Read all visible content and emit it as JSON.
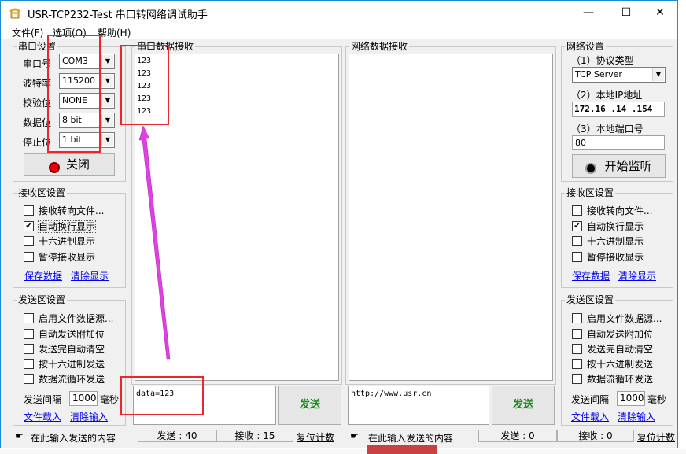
{
  "window": {
    "title": "USR-TCP232-Test 串口转网络调试助手",
    "minimize": "—",
    "maximize": "☐",
    "close": "✕"
  },
  "menu": [
    "文件(F)",
    "选项(O)",
    "帮助(H)"
  ],
  "serial_settings": {
    "title": "串口设置",
    "fields": [
      {
        "label": "串口号",
        "value": "COM3"
      },
      {
        "label": "波特率",
        "value": "115200"
      },
      {
        "label": "校验位",
        "value": "NONE"
      },
      {
        "label": "数据位",
        "value": "8 bit"
      },
      {
        "label": "停止位",
        "value": "1 bit"
      }
    ],
    "button": "关闭"
  },
  "left_receive": {
    "title": "接收区设置",
    "options": [
      {
        "label": "接收转向文件...",
        "checked": false
      },
      {
        "label": "自动换行显示",
        "checked": true
      },
      {
        "label": "十六进制显示",
        "checked": false
      },
      {
        "label": "暂停接收显示",
        "checked": false
      }
    ],
    "link1": "保存数据",
    "link2": "清除显示"
  },
  "left_send": {
    "title": "发送区设置",
    "options": [
      {
        "label": "启用文件数据源...",
        "checked": false
      },
      {
        "label": "自动发送附加位",
        "checked": false
      },
      {
        "label": "发送完自动清空",
        "checked": false
      },
      {
        "label": "按十六进制发送",
        "checked": false
      },
      {
        "label": "数据流循环发送",
        "checked": false
      }
    ],
    "interval_label": "发送间隔",
    "interval_value": "1000",
    "interval_unit": "毫秒",
    "link1": "文件载入",
    "link2": "清除输入"
  },
  "serial_rx": {
    "title": "串口数据接收",
    "lines": [
      "123",
      "123",
      "123",
      "123",
      "123"
    ]
  },
  "net_rx": {
    "title": "网络数据接收"
  },
  "serial_tx": {
    "text": "data=123",
    "button": "发送"
  },
  "net_tx": {
    "text": "http://www.usr.cn",
    "button": "发送"
  },
  "network_settings": {
    "title": "网络设置",
    "protocol_label": "（1）协议类型",
    "protocol_value": "TCP Server",
    "ip_label": "（2）本地IP地址",
    "ip_value": "172.16 .14 .154",
    "port_label": "（3）本地端口号",
    "port_value": "80",
    "button": "开始监听"
  },
  "right_receive": {
    "title": "接收区设置",
    "options": [
      {
        "label": "接收转向文件...",
        "checked": false
      },
      {
        "label": "自动换行显示",
        "checked": true
      },
      {
        "label": "十六进制显示",
        "checked": false
      },
      {
        "label": "暂停接收显示",
        "checked": false
      }
    ],
    "link1": "保存数据",
    "link2": "清除显示"
  },
  "right_send": {
    "title": "发送区设置",
    "options": [
      {
        "label": "启用文件数据源...",
        "checked": false
      },
      {
        "label": "自动发送附加位",
        "checked": false
      },
      {
        "label": "发送完自动清空",
        "checked": false
      },
      {
        "label": "按十六进制发送",
        "checked": false
      },
      {
        "label": "数据流循环发送",
        "checked": false
      }
    ],
    "interval_label": "发送间隔",
    "interval_value": "1000",
    "interval_unit": "毫秒",
    "link1": "文件载入",
    "link2": "清除输入"
  },
  "status_left": {
    "hint": "在此输入发送的内容",
    "sent": "发送 : 40",
    "recv": "接收 : 15",
    "reset": "复位计数"
  },
  "status_right": {
    "hint": "在此输入发送的内容",
    "sent": "发送 : 0",
    "recv": "接收 : 0",
    "reset": "复位计数"
  },
  "annotation_color": "#e8282e",
  "arrow_color": "#e040e0"
}
